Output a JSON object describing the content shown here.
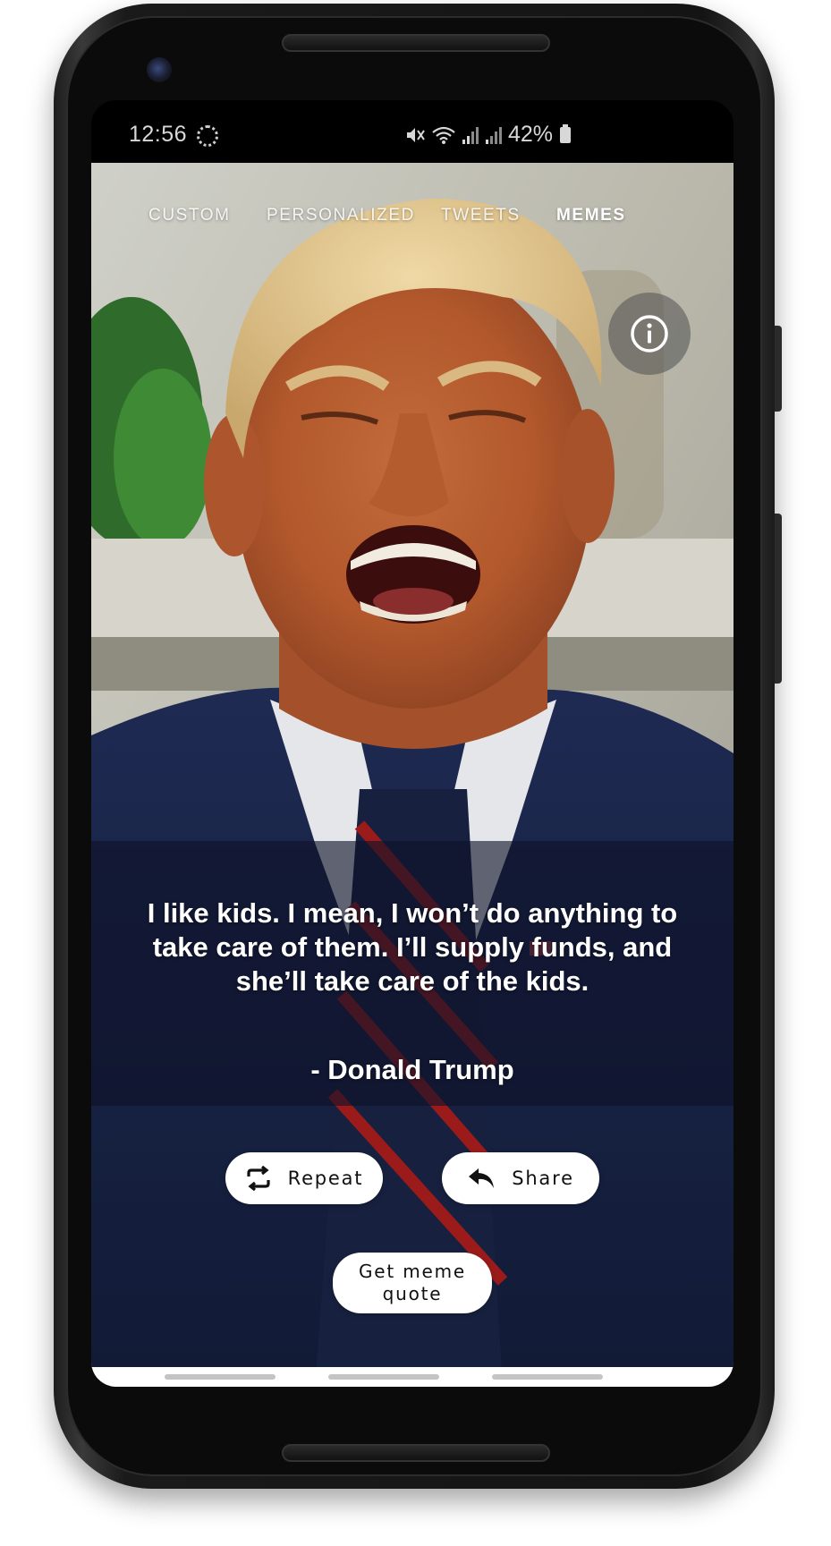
{
  "status_bar": {
    "time": "12:56",
    "battery_percent": "42%",
    "icons": [
      "spinner-icon",
      "mute-icon",
      "wifi-icon",
      "signal-icon",
      "signal-icon",
      "battery-icon"
    ]
  },
  "tabs": [
    {
      "label": "CUSTOM",
      "active": false
    },
    {
      "label": "PERSONALIZED",
      "active": false
    },
    {
      "label": "TWEETS",
      "active": false
    },
    {
      "label": "MEMES",
      "active": true
    }
  ],
  "info_button": {
    "icon": "info-icon"
  },
  "quote": {
    "text": "I like kids. I mean, I won’t do anything to take care of them. I’ll supply funds, and she’ll take care of the kids.",
    "author": "- Donald Trump"
  },
  "actions": {
    "repeat_label": "Repeat",
    "repeat_icon": "repeat-icon",
    "share_label": "Share",
    "share_icon": "share-reply-icon",
    "get_meme_label": "Get meme quote"
  },
  "colors": {
    "quote_band": "#0e1228",
    "button_bg": "#ffffff",
    "tab_text": "#ffffff"
  }
}
